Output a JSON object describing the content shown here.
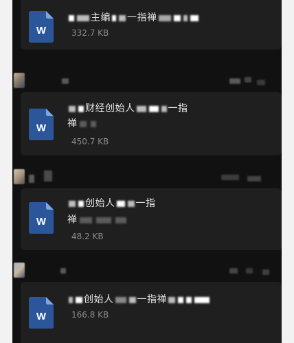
{
  "messages": [
    {
      "name_before": "",
      "name_mid": "主编",
      "name_after": "一指禅",
      "name_line2": "",
      "size": "332.7 KB"
    },
    {
      "name_before": "",
      "name_mid": "财经创始人",
      "name_after": "一指",
      "name_line2": "禅",
      "size": "450.7 KB"
    },
    {
      "name_before": "",
      "name_mid": "创始人",
      "name_after": "一指",
      "name_line2": "禅",
      "size": "48.2 KB"
    },
    {
      "name_before": "",
      "name_mid": "创始人",
      "name_after": "一指禅",
      "name_line2": "",
      "size": "166.8 KB"
    }
  ],
  "icon": {
    "type": "word-document-icon",
    "letter": "W",
    "color": "#2b579a",
    "fold_color": "#7ea6e0"
  },
  "colors": {
    "background": "#111111",
    "card": "#1f1f1f",
    "title_text": "#e6e6e6",
    "size_text": "#8a8a8a"
  }
}
